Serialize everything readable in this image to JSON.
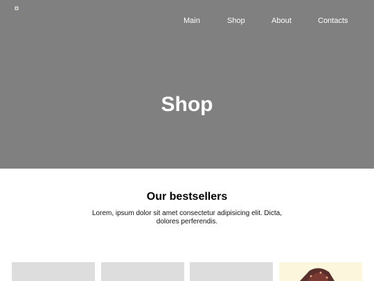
{
  "nav": {
    "items": [
      {
        "label": "Main"
      },
      {
        "label": "Shop"
      },
      {
        "label": "About"
      },
      {
        "label": "Contacts"
      }
    ]
  },
  "hero": {
    "title": "Shop"
  },
  "bestsellers": {
    "title": "Our bestsellers",
    "description": "Lorem, ipsum dolor sit amet consectetur adipisicing elit. Dicta, dolores perferendis."
  },
  "colors": {
    "hero_background": "#808080",
    "card_placeholder": "#dddddd",
    "card_image_background": "#fbf6dc"
  }
}
